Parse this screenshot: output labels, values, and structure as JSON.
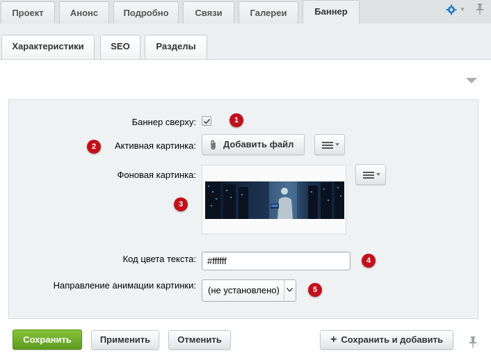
{
  "tabs": {
    "items": [
      {
        "label": "Проект"
      },
      {
        "label": "Анонс"
      },
      {
        "label": "Подробно"
      },
      {
        "label": "Связи"
      },
      {
        "label": "Галереи"
      },
      {
        "label": "Баннер",
        "active": true
      }
    ],
    "subtabs": [
      {
        "label": "Характеристики"
      },
      {
        "label": "SEO"
      },
      {
        "label": "Разделы"
      }
    ]
  },
  "form": {
    "banner_top": {
      "label": "Баннер сверху:",
      "checked": true,
      "badge": "1"
    },
    "active_image": {
      "label": "Активная картинка:",
      "button": "Добавить файл",
      "badge": "2"
    },
    "background_image": {
      "label": "Фоновая картинка:",
      "badge": "3"
    },
    "text_color": {
      "label": "Код цвета текста:",
      "value": "#ffffff",
      "badge": "4"
    },
    "animation_direction": {
      "label": "Направление анимации картинки:",
      "value": "(не установлено)",
      "badge": "5"
    }
  },
  "footer": {
    "save": "Сохранить",
    "apply": "Применить",
    "cancel": "Отменить",
    "save_add": "Сохранить и добавить"
  },
  "colors": {
    "badge": "#c1101a",
    "save_button": "#6aa826",
    "panel_bg": "#eef2f3"
  }
}
